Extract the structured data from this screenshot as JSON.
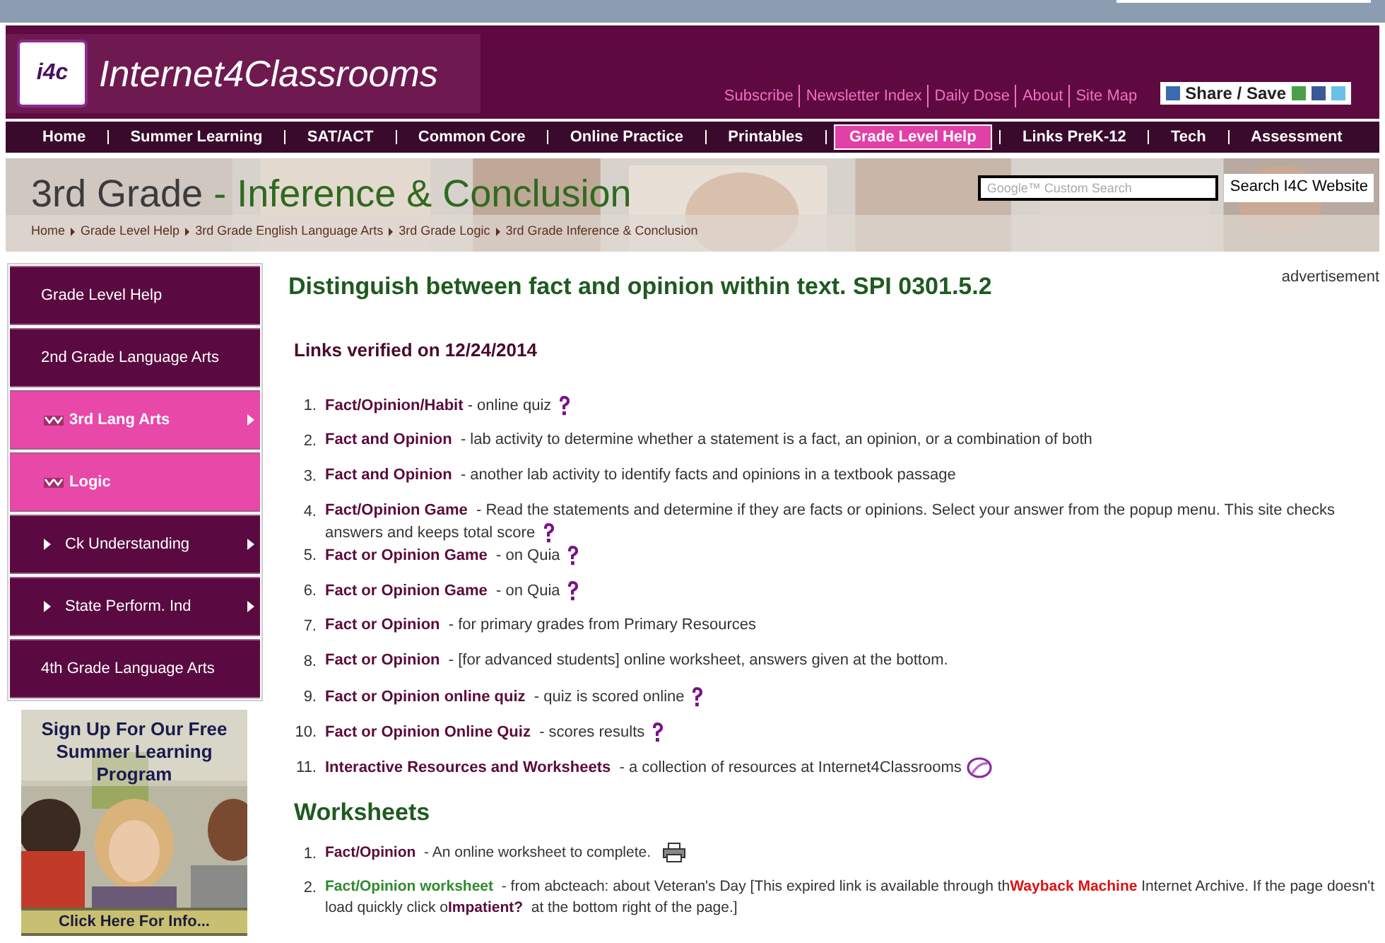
{
  "header": {
    "logo_mark": "i4c",
    "site_name": "Internet4Classrooms",
    "links": [
      "Subscribe",
      "Newsletter Index",
      "Daily Dose",
      "About",
      "Site Map"
    ],
    "share_button": "Share / Save"
  },
  "nav": [
    {
      "label": "Home",
      "selected": false
    },
    {
      "label": "Summer Learning",
      "selected": false
    },
    {
      "label": "SAT/ACT",
      "selected": false
    },
    {
      "label": "Common Core",
      "selected": false
    },
    {
      "label": "Online Practice",
      "selected": false
    },
    {
      "label": "Printables",
      "selected": false
    },
    {
      "label": "Grade Level Help",
      "selected": true
    },
    {
      "label": "Links PreK-12",
      "selected": false
    },
    {
      "label": "Tech",
      "selected": false
    },
    {
      "label": "Assessment",
      "selected": false
    }
  ],
  "banner": {
    "title_grade": "3rd Grade",
    "title_rest": " - Inference & Conclusion",
    "search": {
      "placeholder": "Google™ Custom Search",
      "button": "Search I4C Website"
    },
    "breadcrumb": [
      "Home",
      "Grade Level Help",
      "3rd Grade English Language Arts",
      "3rd Grade Logic",
      "3rd Grade Inference & Conclusion"
    ]
  },
  "sidebar": {
    "items": [
      {
        "label": "Grade Level Help",
        "kind": "top",
        "selected": false,
        "submenu": false
      },
      {
        "label": "2nd Grade Language Arts",
        "kind": "top",
        "selected": false,
        "submenu": false
      },
      {
        "label": "3rd Lang Arts",
        "kind": "open",
        "selected": true,
        "submenu": true
      },
      {
        "label": "Logic",
        "kind": "open",
        "selected": true,
        "submenu": false
      },
      {
        "label": "Ck Understanding",
        "kind": "sub",
        "selected": false,
        "submenu": true
      },
      {
        "label": "State Perform. Ind",
        "kind": "sub",
        "selected": false,
        "submenu": true
      },
      {
        "label": "4th Grade Language Arts",
        "kind": "top",
        "selected": false,
        "submenu": false
      }
    ],
    "ad": {
      "headline": "Sign Up For Our Free Summer Learning Program",
      "footer": "Click Here For Info..."
    }
  },
  "main": {
    "title": "Distinguish between fact and opinion within text. SPI 0301.5.2",
    "advertisement": "advertisement",
    "verified": "Links verified on 12/24/2014",
    "links": [
      {
        "number": "1.",
        "link": "Fact/Opinion/Habit",
        "desc": " - online quiz",
        "kind": "quiz"
      },
      {
        "number": "2.",
        "link": "Fact and Opinion",
        "desc": "  - lab activity to determine whether a statement is a fact, an opinion, or a combination of both",
        "kind": "plain"
      },
      {
        "number": "3.",
        "link": "Fact and Opinion",
        "desc": "  - another lab activity to identify facts and opinions in a textbook passage",
        "kind": "plain"
      },
      {
        "number": "4.",
        "link": "Fact/Opinion Game",
        "desc": "  - Read the statements and determine if they are facts or opinions. Select your answer from the popup menu. This site checks answers and keeps total score",
        "kind": "quiz"
      },
      {
        "number": "5.",
        "link": "Fact or Opinion Game",
        "desc": "  - on Quia",
        "kind": "quiz"
      },
      {
        "number": "6.",
        "link": "Fact or Opinion Game",
        "desc": "  - on Quia",
        "kind": "quiz"
      },
      {
        "number": "7.",
        "link": "Fact or Opinion",
        "desc": "  - for primary grades from Primary Resources",
        "kind": "plain"
      },
      {
        "number": "8.",
        "link": "Fact or Opinion",
        "desc": "  - [for advanced students] online worksheet, answers given at the bottom.",
        "kind": "plain"
      },
      {
        "number": "9.",
        "link": "Fact or Opinion online quiz",
        "desc": "  - quiz is scored online",
        "kind": "quiz"
      },
      {
        "number": "10.",
        "link": "Fact or Opinion Online Quiz",
        "desc": "  - scores results",
        "kind": "quiz"
      },
      {
        "number": "11.",
        "link": "Interactive Resources and Worksheets",
        "desc": "  - a collection of resources at Internet4Classrooms",
        "kind": "collection"
      }
    ],
    "worksheets_heading": "Worksheets",
    "worksheets": [
      {
        "number": "1.",
        "parts": [
          {
            "kind": "link",
            "text": "Fact/Opinion"
          },
          {
            "kind": "text",
            "text": "  - An online worksheet to complete."
          }
        ],
        "kind": "printable"
      },
      {
        "number": "2.",
        "parts": [
          {
            "kind": "green_link",
            "text": "Fact/Opinion worksheet"
          },
          {
            "kind": "text",
            "text": "  - from abcteach: about Veteran's Day [This expired link is available through th"
          },
          {
            "kind": "red_link",
            "text": "Wayback Machine"
          },
          {
            "kind": "text",
            "text": " Internet Archive. If the page doesn't load quickly click o"
          },
          {
            "kind": "link",
            "text": "Impatient?"
          },
          {
            "kind": "text",
            "text": "  at the bottom right of the page.]"
          }
        ],
        "kind": "plain"
      }
    ]
  }
}
